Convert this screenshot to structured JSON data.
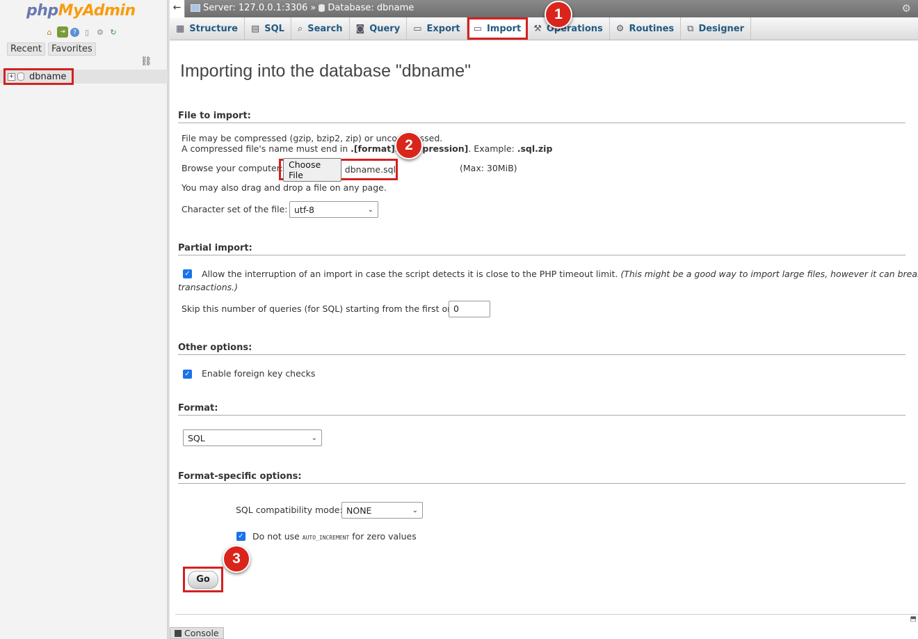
{
  "nav": {
    "logo_php": "php",
    "logo_my": "My",
    "logo_admin": "Admin",
    "quick_icons": [
      "home-icon",
      "exit-icon",
      "help-icon",
      "docs-icon",
      "settings-icon",
      "reload-icon"
    ],
    "recent_label": "Recent",
    "favorites_label": "Favorites",
    "tree": [
      {
        "expander": "+",
        "name": "dbname"
      }
    ]
  },
  "topbar": {
    "back_label": "←",
    "server_label": "Server: 127.0.0.1:3306",
    "separator": "»",
    "database_label": "Database: dbname"
  },
  "tabs": [
    {
      "label": "Structure",
      "icon": "structure-icon"
    },
    {
      "label": "SQL",
      "icon": "sql-icon"
    },
    {
      "label": "Search",
      "icon": "search-icon"
    },
    {
      "label": "Query",
      "icon": "query-icon"
    },
    {
      "label": "Export",
      "icon": "export-icon"
    },
    {
      "label": "Import",
      "icon": "import-icon",
      "active": true
    },
    {
      "label": "Operations",
      "icon": "operations-icon"
    },
    {
      "label": "Routines",
      "icon": "routines-icon"
    },
    {
      "label": "Designer",
      "icon": "designer-icon"
    }
  ],
  "markers": [
    "1",
    "2",
    "3"
  ],
  "page": {
    "title": "Importing into the database \"dbname\""
  },
  "file_import": {
    "heading": "File to import:",
    "compress_line1": "File may be compressed (gzip, bzip2, zip) or uncompressed.",
    "compress_line2_prefix": "A compressed file's name must end in ",
    "compress_line2_bold": ".[format].[compression]",
    "compress_line2_mid": ". Example: ",
    "compress_line2_example": ".sql.zip",
    "browse_label": "Browse your computer:",
    "choose_file_label": "Choose File",
    "file_name": "dbname.sql",
    "max_size": "(Max: 30MiB)",
    "drag_drop_text": "You may also drag and drop a file on any page.",
    "charset_label": "Character set of the file:",
    "charset_value": "utf-8"
  },
  "partial_import": {
    "heading": "Partial import:",
    "allow_interrupt_checked": true,
    "allow_interrupt_text": "Allow the interruption of an import in case the script detects it is close to the PHP timeout limit.",
    "allow_interrupt_note_1": "(This might be a good way to import large files, however it can break",
    "allow_interrupt_note_2": "transactions.)",
    "skip_label": "Skip this number of queries (for SQL) starting from the first one:",
    "skip_value": "0"
  },
  "other_options": {
    "heading": "Other options:",
    "foreign_key_checked": true,
    "foreign_key_label": "Enable foreign key checks"
  },
  "format": {
    "heading": "Format:",
    "value": "SQL"
  },
  "format_specific": {
    "heading": "Format-specific options:",
    "compat_label": "SQL compatibility mode:",
    "compat_value": "NONE",
    "auto_inc_checked": true,
    "auto_inc_prefix": "Do not use ",
    "auto_inc_code": "AUTO_INCREMENT",
    "auto_inc_suffix": " for zero values"
  },
  "actions": {
    "go_label": "Go"
  },
  "console": {
    "label": "Console"
  },
  "colors": {
    "highlight_red": "#d42020",
    "marker_red": "#d9251c",
    "tab_text": "#235a81",
    "checkbox_blue": "#1a73e8"
  }
}
